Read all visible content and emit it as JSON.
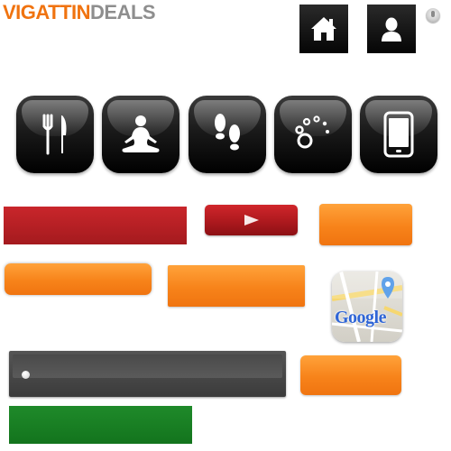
{
  "logo": {
    "part1": "VIGATTIN",
    "part2": "DEALS"
  },
  "top_icons": [
    "home-icon",
    "user-icon",
    "info-icon"
  ],
  "categories": [
    {
      "icon": "fork-knife-icon"
    },
    {
      "icon": "meditation-icon"
    },
    {
      "icon": "footsteps-icon"
    },
    {
      "icon": "dots-spinner-icon"
    },
    {
      "icon": "phone-icon"
    }
  ],
  "google_maps": {
    "label": "Google"
  },
  "slider": {
    "value": 0
  },
  "colors": {
    "brand_orange": "#f0730f",
    "brand_gray": "#8e8e8e",
    "red": "#c9262b",
    "green": "#1f8a2a"
  }
}
